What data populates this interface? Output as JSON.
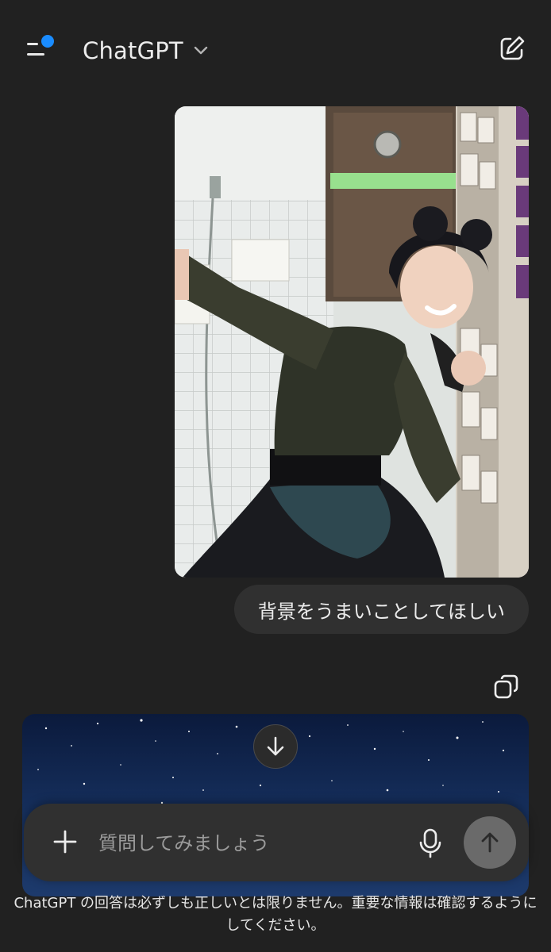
{
  "header": {
    "title": "ChatGPT"
  },
  "conversation": {
    "user_message": "背景をうまいことしてほしい"
  },
  "composer": {
    "placeholder": "質問してみましょう"
  },
  "footer": {
    "disclaimer": "ChatGPT の回答は必ずしも正しいとは限りません。重要な情報は確認するようにしてください。"
  },
  "colors": {
    "background": "#212121",
    "bubble": "#303030",
    "notification_dot": "#1a8cff",
    "send_button": "#6a6a6a"
  },
  "icons": [
    "menu-icon",
    "chevron-down-icon",
    "new-chat-icon",
    "copy-icon",
    "arrow-down-icon",
    "plus-icon",
    "microphone-icon",
    "arrow-up-icon"
  ]
}
